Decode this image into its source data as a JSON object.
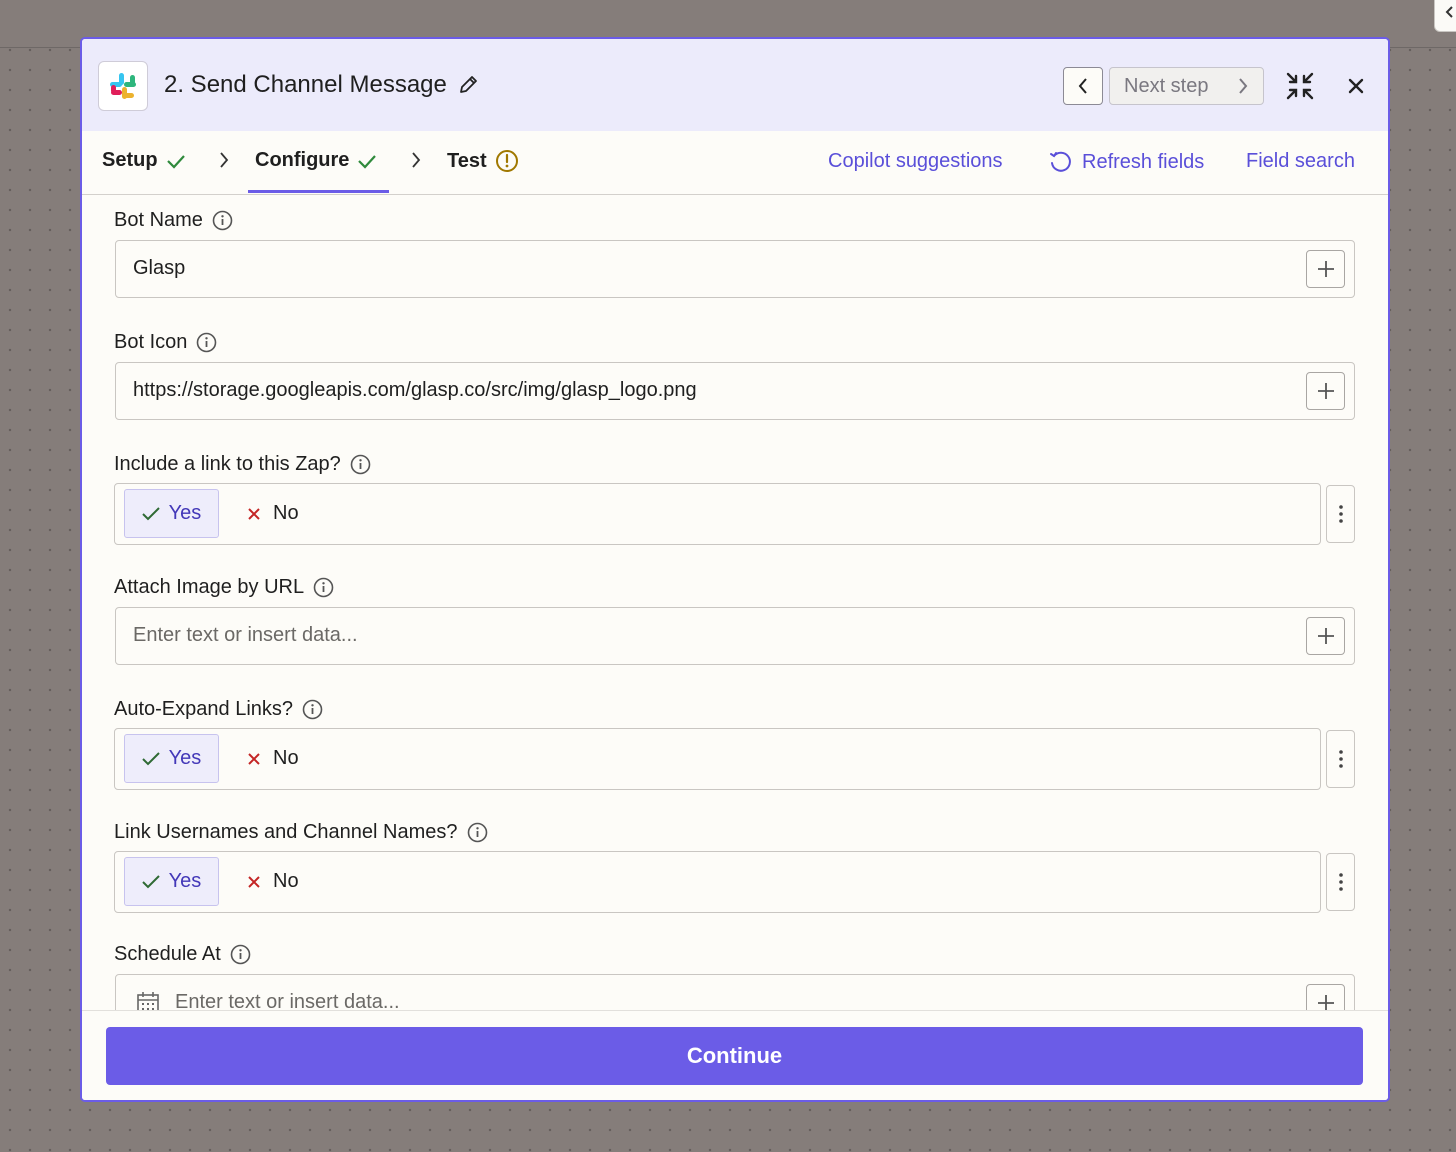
{
  "colors": {
    "accent": "#6b5ce7",
    "link": "#5a4fd9",
    "header_bg": "#ecebfb",
    "success": "#2f8a3c",
    "warning": "#a07800",
    "danger": "#c42525"
  },
  "header": {
    "app_icon": "slack-logo",
    "title": "2. Send Channel Message",
    "edit_icon": "pencil-icon",
    "prev_icon": "chevron-left-icon",
    "next_label": "Next step",
    "next_icon": "chevron-right-icon",
    "collapse_icon": "collapse-arrows-icon",
    "close_icon": "close-icon"
  },
  "tabs": {
    "setup": {
      "label": "Setup",
      "status": "complete"
    },
    "configure": {
      "label": "Configure",
      "status": "complete",
      "active": true
    },
    "test": {
      "label": "Test",
      "status": "warning"
    },
    "actions": {
      "copilot": "Copilot suggestions",
      "refresh": "Refresh fields",
      "field_search": "Field search"
    }
  },
  "fields": {
    "bot_name": {
      "label": "Bot Name",
      "value": "Glasp"
    },
    "bot_icon": {
      "label": "Bot Icon",
      "value": "https://storage.googleapis.com/glasp.co/src/img/glasp_logo.png"
    },
    "include_link": {
      "label": "Include a link to this Zap?",
      "yes": "Yes",
      "no": "No",
      "selected": "Yes"
    },
    "attach_image": {
      "label": "Attach Image by URL",
      "placeholder": "Enter text or insert data..."
    },
    "auto_expand": {
      "label": "Auto-Expand Links?",
      "yes": "Yes",
      "no": "No",
      "selected": "Yes"
    },
    "link_names": {
      "label": "Link Usernames and Channel Names?",
      "yes": "Yes",
      "no": "No",
      "selected": "Yes"
    },
    "schedule_at": {
      "label": "Schedule At",
      "placeholder": "Enter text or insert data..."
    }
  },
  "footer": {
    "continue_label": "Continue"
  }
}
